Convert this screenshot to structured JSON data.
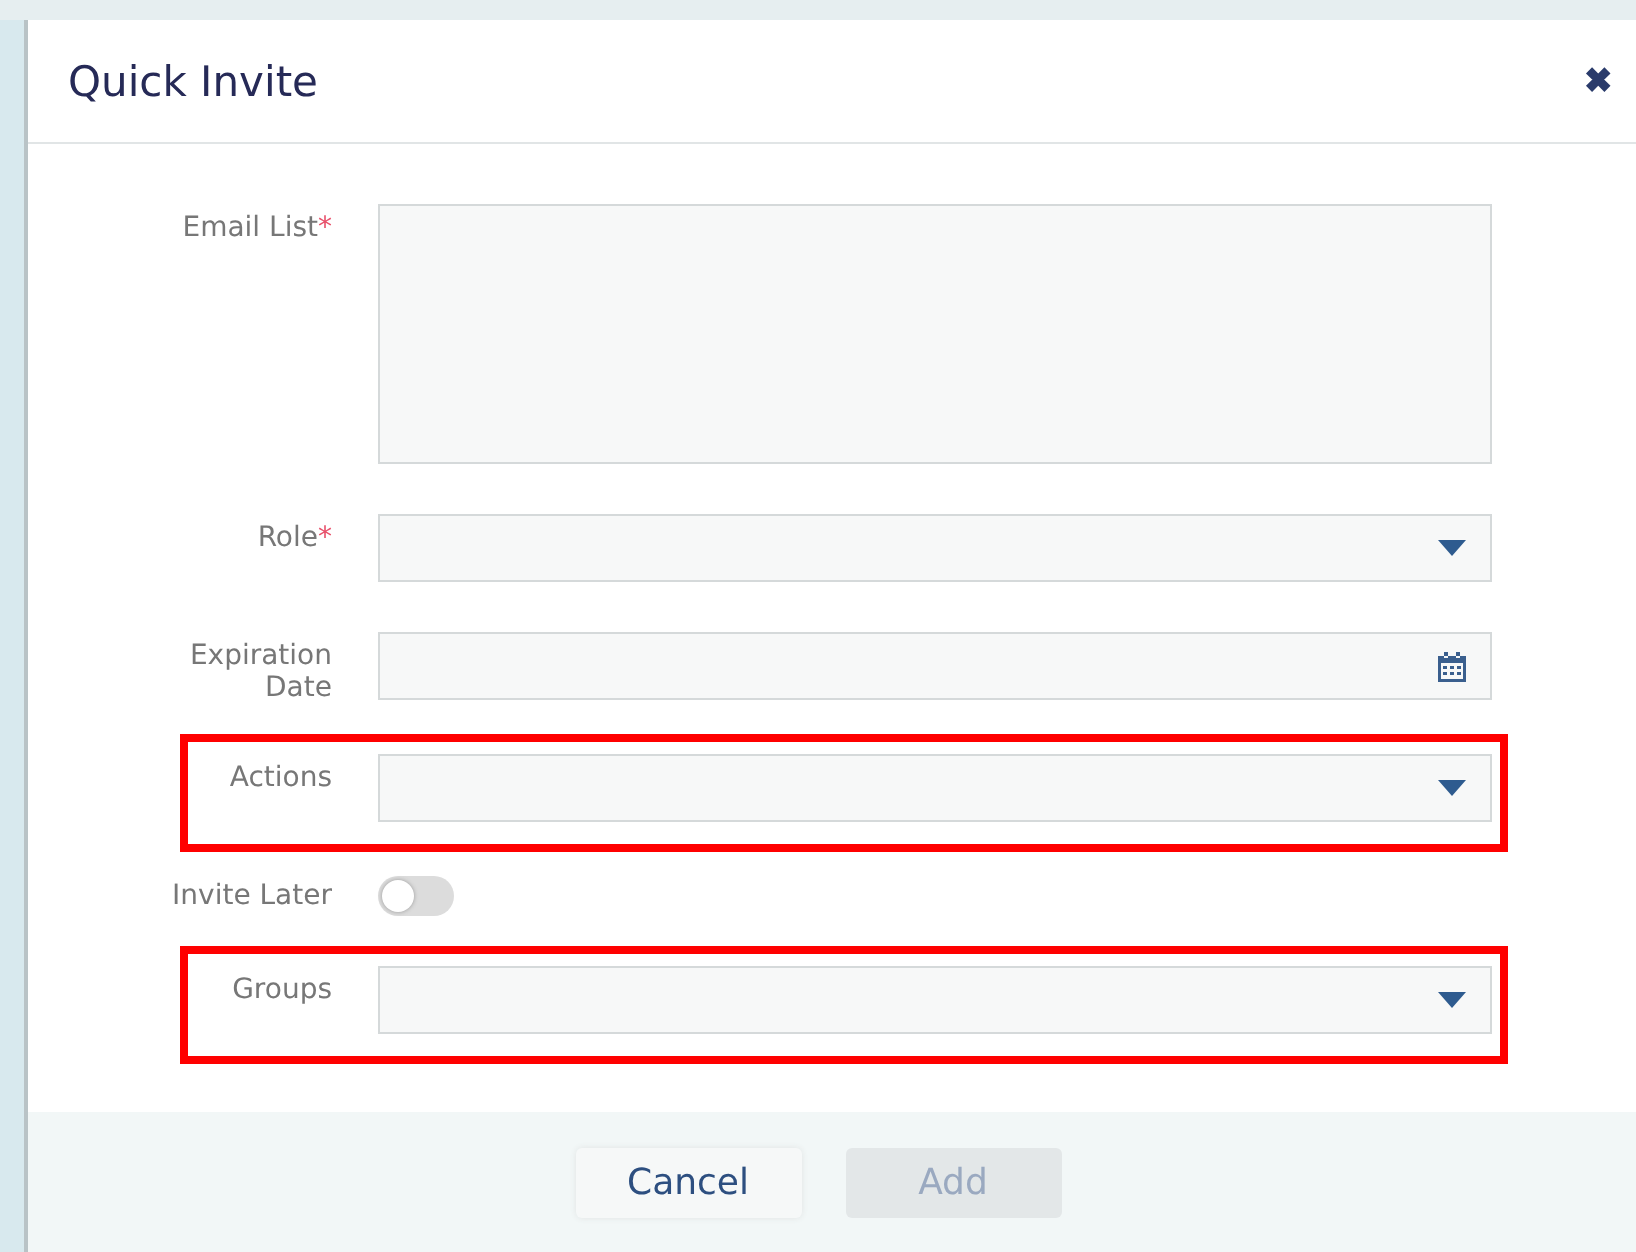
{
  "dialog": {
    "title": "Quick Invite",
    "close_icon": "✖"
  },
  "fields": [
    {
      "kind": "textarea",
      "label": "Email List",
      "required_mark": "*",
      "highlighted": false
    },
    {
      "kind": "select",
      "label": "Role",
      "required_mark": "*",
      "highlighted": false
    },
    {
      "kind": "date",
      "label": "Expiration Date",
      "highlighted": false
    },
    {
      "kind": "select",
      "label": "Actions",
      "highlighted": true
    },
    {
      "kind": "toggle",
      "label": "Invite Later",
      "on": false,
      "highlighted": false
    },
    {
      "kind": "select",
      "label": "Groups",
      "highlighted": true
    }
  ],
  "buttons": [
    {
      "label": "Cancel",
      "disabled": false
    },
    {
      "label": "Add",
      "disabled": true
    }
  ]
}
